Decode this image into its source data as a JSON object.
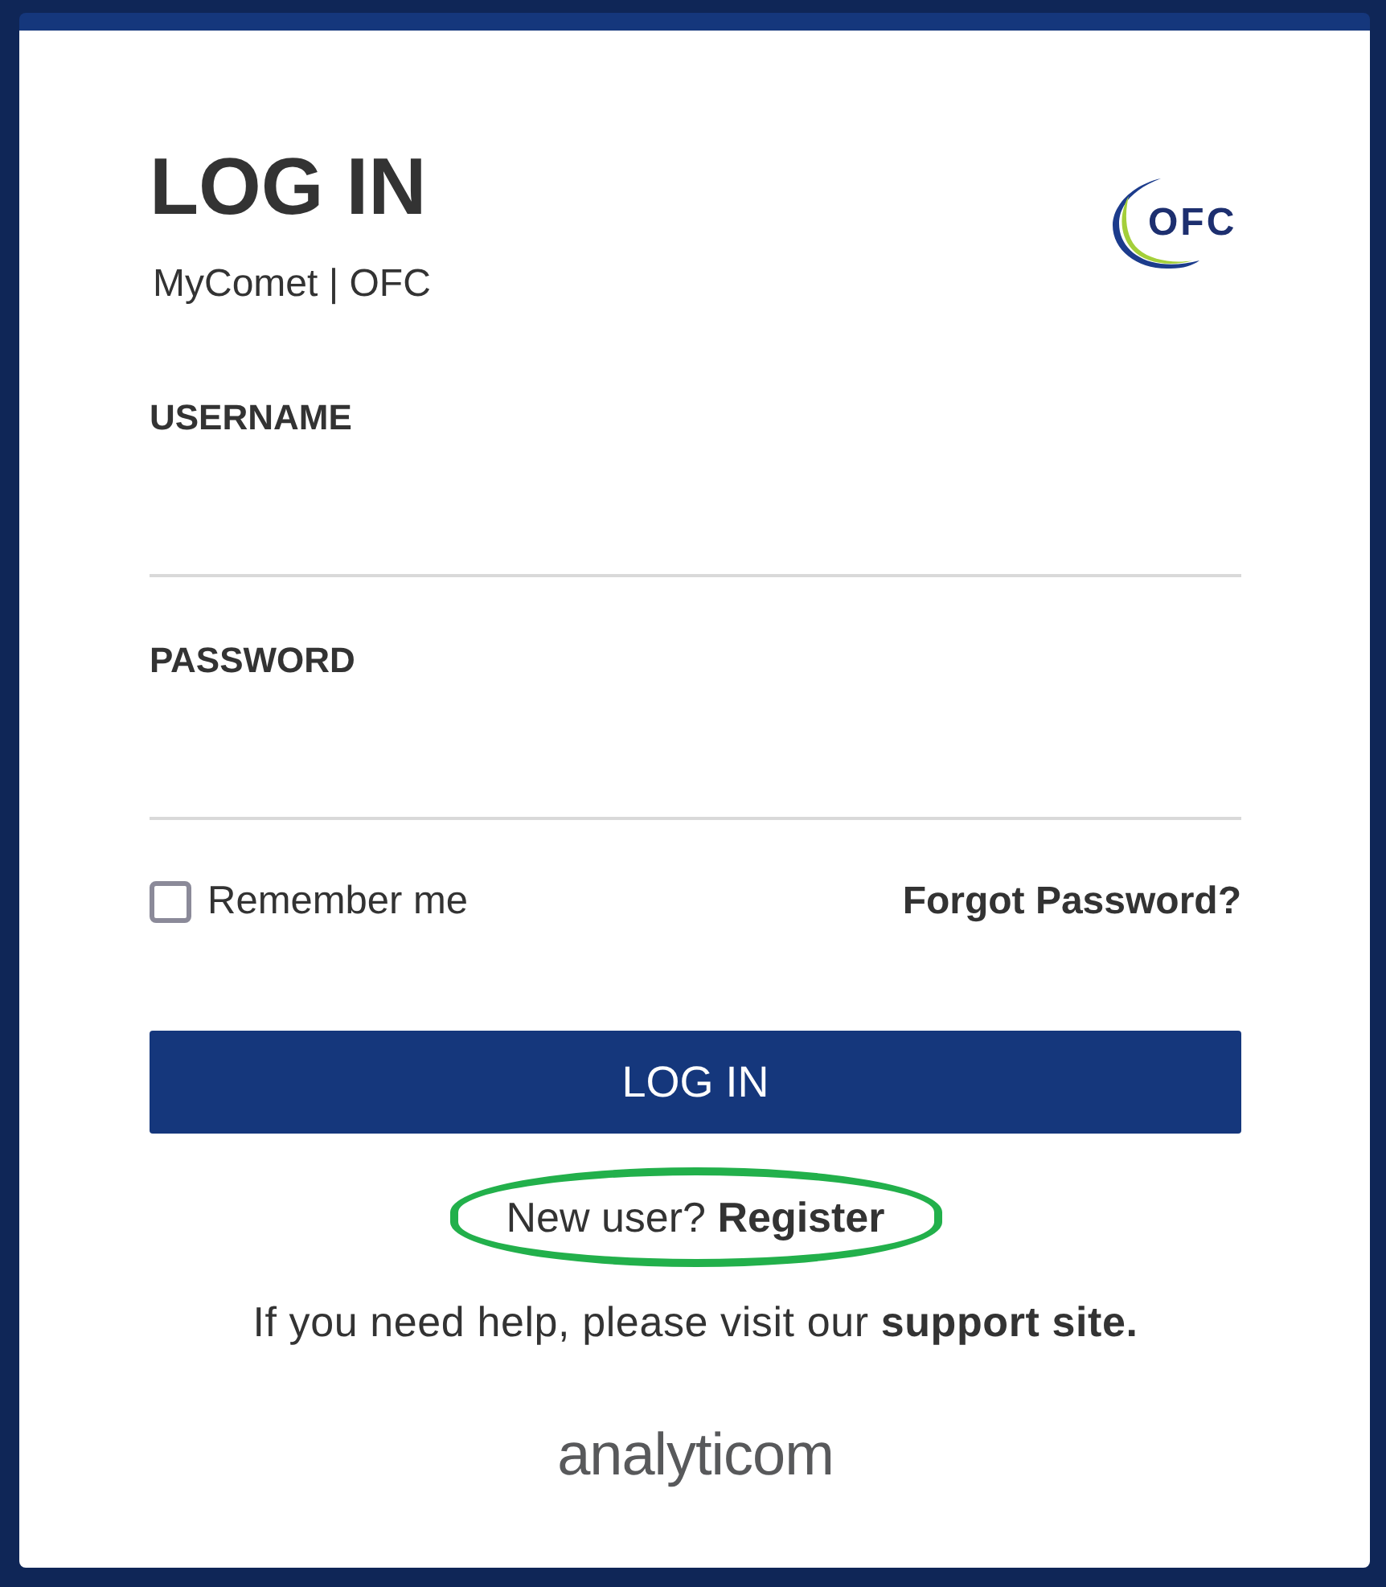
{
  "title": "LOG IN",
  "subtitle": "MyComet | OFC",
  "logo": {
    "text": "OFC"
  },
  "fields": [
    {
      "label": "USERNAME"
    },
    {
      "label": "PASSWORD"
    }
  ],
  "remember": {
    "label": "Remember me",
    "checked": false
  },
  "forgot_link": "Forgot Password?",
  "submit": "LOG IN",
  "register": {
    "text": "New user?",
    "link": "Register",
    "highlighted": true
  },
  "help": {
    "text": "If you need help, please visit our",
    "link": "support site."
  },
  "footer_logo": {
    "text": "analyticom"
  }
}
